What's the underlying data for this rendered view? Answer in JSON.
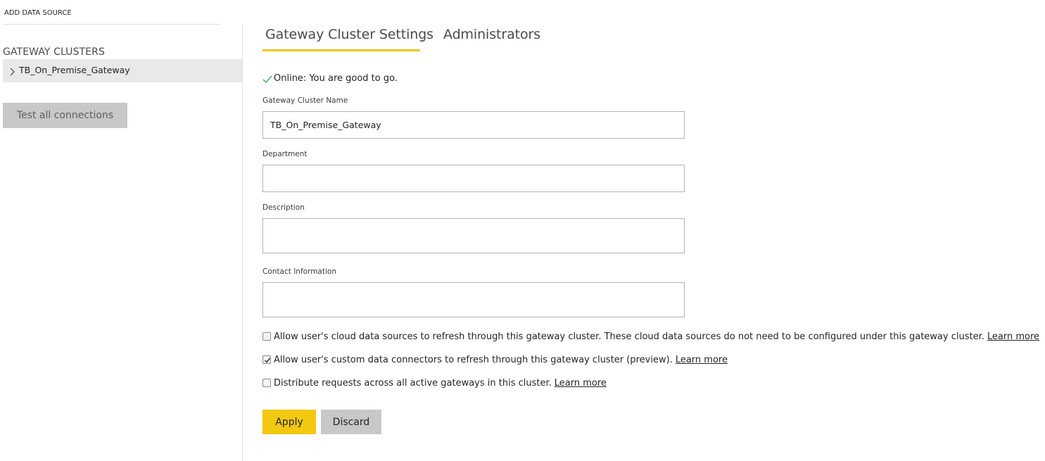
{
  "colors": {
    "accent": "#f2c811",
    "success": "#3aa655",
    "selected_bg": "#e9e9e9",
    "button_gray": "#c8c8c8"
  },
  "left_panel": {
    "add_data_source": "ADD DATA SOURCE",
    "clusters_heading": "GATEWAY CLUSTERS",
    "cluster_item": {
      "label": "TB_On_Premise_Gateway",
      "icon": "chevron-right-icon",
      "selected": true
    },
    "test_button": "Test all connections"
  },
  "tabs": [
    {
      "label": "Gateway Cluster Settings",
      "active": true
    },
    {
      "label": "Administrators",
      "active": false
    }
  ],
  "status": {
    "icon": "checkmark-icon",
    "text": "Online: You are good to go."
  },
  "fields": {
    "name": {
      "label": "Gateway Cluster Name",
      "value": "TB_On_Premise_Gateway"
    },
    "department": {
      "label": "Department",
      "value": ""
    },
    "description": {
      "label": "Description",
      "value": ""
    },
    "contact": {
      "label": "Contact Information",
      "value": ""
    }
  },
  "options": [
    {
      "text": "Allow user's cloud data sources to refresh through this gateway cluster. These cloud data sources do not need to be configured under this gateway cluster.",
      "link": "Learn more",
      "checked": false
    },
    {
      "text": "Allow user's custom data connectors to refresh through this gateway cluster (preview).",
      "link": "Learn more",
      "checked": true
    },
    {
      "text": "Distribute requests across all active gateways in this cluster.",
      "link": "Learn more",
      "checked": false
    }
  ],
  "actions": {
    "apply": "Apply",
    "discard": "Discard"
  }
}
